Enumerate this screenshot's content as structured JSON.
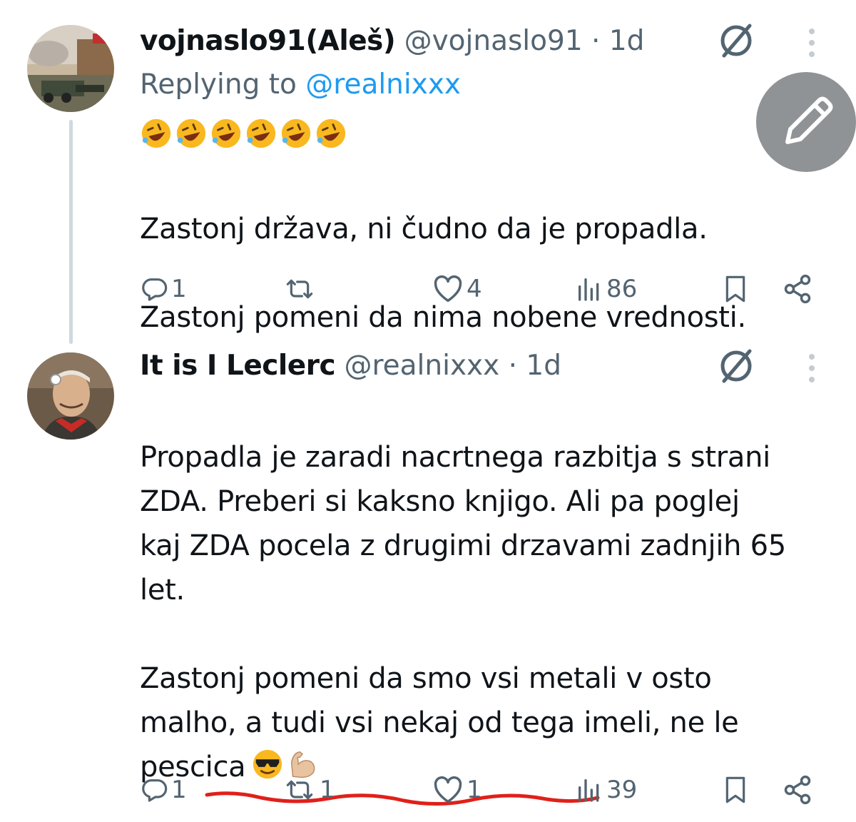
{
  "tweets": [
    {
      "name": "vojnaslo91(Aleš)",
      "handle": "@vojnaslo91",
      "sep": " · ",
      "time": "1d",
      "replying_prefix": "Replying to ",
      "replying_to": "@realnixxx",
      "emoji_line": [
        "rofl-emoji",
        "rofl-emoji",
        "rofl-emoji",
        "rofl-emoji",
        "rofl-emoji",
        "rofl-emoji"
      ],
      "text_lines": [
        "Zastonj država, ni čudno da je propadla.",
        "Zastonj pomeni da nima nobene vrednosti."
      ],
      "stats": {
        "replies": "1",
        "reposts": "",
        "likes": "4",
        "views": "86"
      }
    },
    {
      "name": "It is I Leclerc",
      "handle": "@realnixxx",
      "sep": " · ",
      "time": "1d",
      "text_before": "Propadla je zaradi nacrtnega razbitja s strani\nZDA. Preberi si kaksno knjigo. Ali pa poglej\nkaj ZDA pocela z drugimi drzavami zadnjih 65\nlet.\n\nZastonj pomeni da smo vsi metali v osto\nmalho, a tudi vsi nekaj od tega imeli, ne le\npescica",
      "trailing_emojis": [
        "sunglasses-emoji",
        "flexed-biceps-emoji"
      ],
      "stats": {
        "replies": "1",
        "reposts": "1",
        "likes": "1",
        "views": "39"
      }
    }
  ],
  "colors": {
    "text": "#0f1419",
    "secondary": "#536471",
    "link": "#1d9bf0",
    "fab": "#8f9396",
    "annotation": "#e0201a"
  },
  "icons": [
    "reply-icon",
    "repost-icon",
    "like-icon",
    "views-icon",
    "bookmark-icon",
    "share-icon",
    "grok-icon",
    "more-icon",
    "compose-icon"
  ]
}
